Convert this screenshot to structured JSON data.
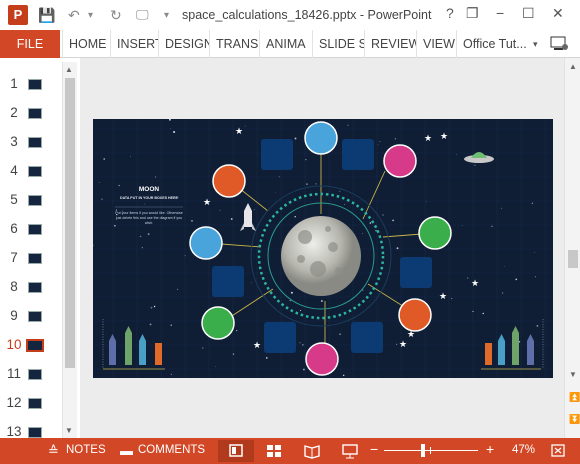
{
  "window": {
    "title": "space_calculations_18426.pptx - PowerPoint",
    "app_icon": "P",
    "help": "?",
    "restore": "❐",
    "minimize": "−",
    "maximize": "☐",
    "close": "✕"
  },
  "qat": {
    "save": "💾",
    "undo": "↶",
    "redo": "↻",
    "present": "🖵",
    "more": "▾"
  },
  "ribbon": {
    "file": "FILE",
    "tabs": [
      "HOME",
      "INSERT",
      "DESIGN",
      "TRANSI",
      "ANIMA",
      "SLIDE S",
      "REVIEW",
      "VIEW"
    ],
    "account": "Office Tut...",
    "collapse": "⌃"
  },
  "thumbnails": [
    "1",
    "2",
    "3",
    "4",
    "5",
    "6",
    "7",
    "8",
    "9",
    "10",
    "11",
    "12",
    "13"
  ],
  "active_slide": 10,
  "slide": {
    "heading": "MOON",
    "subheading": "DATA PUT IN YOUR BOXES HERE",
    "body": "Put your items if you would like. Otherwise just delete this and use the diagram if you wish."
  },
  "status": {
    "notes": "NOTES",
    "comments": "COMMENTS",
    "zoom_out": "−",
    "zoom_in": "+",
    "zoom": "47%",
    "zoom_level_percent": 47
  },
  "colors": {
    "accent": "#d24726",
    "slide_bg": "#0f1e34",
    "box": "#0c3a73",
    "line": "#c8b44a"
  }
}
